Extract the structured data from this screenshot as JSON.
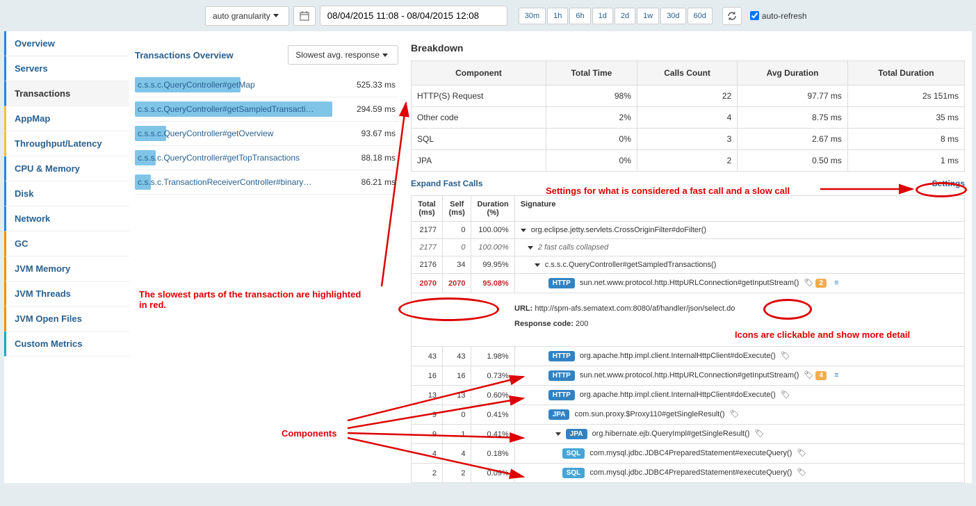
{
  "toolbar": {
    "granularity": "auto granularity",
    "date_range": "08/04/2015 11:08 - 08/04/2015 12:08",
    "ranges": [
      "30m",
      "1h",
      "6h",
      "1d",
      "2d",
      "1w",
      "30d",
      "60d"
    ],
    "auto_refresh": "auto-refresh"
  },
  "sidebar": [
    {
      "label": "Overview",
      "key": "overview"
    },
    {
      "label": "Servers",
      "key": "servers"
    },
    {
      "label": "Transactions",
      "key": "transactions"
    },
    {
      "label": "AppMap",
      "key": "appmap"
    },
    {
      "label": "Throughput/Latency",
      "key": "tl"
    },
    {
      "label": "CPU & Memory",
      "key": "cpu"
    },
    {
      "label": "Disk",
      "key": "disk"
    },
    {
      "label": "Network",
      "key": "network"
    },
    {
      "label": "GC",
      "key": "gc"
    },
    {
      "label": "JVM Memory",
      "key": "jvmm"
    },
    {
      "label": "JVM Threads",
      "key": "jvmt"
    },
    {
      "label": "JVM Open Files",
      "key": "jvmo"
    },
    {
      "label": "Custom Metrics",
      "key": "custom"
    }
  ],
  "trans": {
    "title": "Transactions Overview",
    "sort": "Slowest avg. response",
    "rows": [
      {
        "name": "c.s.s.c.QueryController#getMap",
        "ms": "525.33 ms",
        "w": 40
      },
      {
        "name": "c.s.s.c.QueryController#getSampledTransacti…",
        "ms": "294.59 ms",
        "w": 75
      },
      {
        "name": "c.s.s.c.QueryController#getOverview",
        "ms": "93.67 ms",
        "w": 12
      },
      {
        "name": "c.s.s.c.QueryController#getTopTransactions",
        "ms": "88.18 ms",
        "w": 8
      },
      {
        "name": "c.s.s.c.TransactionReceiverController#binary…",
        "ms": "86.21 ms",
        "w": 6
      }
    ]
  },
  "breakdown": {
    "title": "Breakdown",
    "headers": [
      "Component",
      "Total Time",
      "Calls Count",
      "Avg Duration",
      "Total Duration"
    ],
    "rows": [
      {
        "c": "HTTP(S) Request",
        "tt": "98%",
        "cc": "22",
        "ad": "97.77 ms",
        "td": "2s 151ms"
      },
      {
        "c": "Other code",
        "tt": "2%",
        "cc": "4",
        "ad": "8.75 ms",
        "td": "35 ms"
      },
      {
        "c": "SQL",
        "tt": "0%",
        "cc": "3",
        "ad": "2.67 ms",
        "td": "8 ms"
      },
      {
        "c": "JPA",
        "tt": "0%",
        "cc": "2",
        "ad": "0.50 ms",
        "td": "1 ms"
      }
    ]
  },
  "expand_label": "Expand Fast Calls",
  "settings_label": "Settings",
  "calls": {
    "headers": {
      "total": "Total (ms)",
      "self": "Self (ms)",
      "dur": "Duration (%)",
      "sig": "Signature"
    },
    "rows": [
      {
        "total": "2177",
        "self": "0",
        "dur": "100.00%",
        "sig": "org.eclipse.jetty.servlets.CrossOriginFilter#doFilter()",
        "caret": true
      },
      {
        "total": "2177",
        "self": "0",
        "dur": "100.00%",
        "sig": "2 fast calls collapsed",
        "caret": true,
        "italic": true,
        "indent": 10
      },
      {
        "total": "2176",
        "self": "34",
        "dur": "99.95%",
        "sig": "c.s.s.c.QueryController#getSampledTransactions()",
        "caret": true,
        "indent": 20
      },
      {
        "total": "2070",
        "self": "2070",
        "dur": "95.08%",
        "sig": "sun.net.www.protocol.http.HttpURLConnection#getInputStream()",
        "slow": true,
        "badge": "HTTP",
        "indent": 40,
        "tag": true,
        "count": "2",
        "lines": true
      },
      {
        "total": "43",
        "self": "43",
        "dur": "1.98%",
        "sig": "org.apache.http.impl.client.InternalHttpClient#doExecute()",
        "badge": "HTTP",
        "indent": 40,
        "tag": true
      },
      {
        "total": "16",
        "self": "16",
        "dur": "0.73%",
        "sig": "sun.net.www.protocol.http.HttpURLConnection#getInputStream()",
        "badge": "HTTP",
        "indent": 40,
        "tag": true,
        "count": "4",
        "lines": true
      },
      {
        "total": "13",
        "self": "13",
        "dur": "0.60%",
        "sig": "org.apache.http.impl.client.InternalHttpClient#doExecute()",
        "badge": "HTTP",
        "indent": 40,
        "tag": true
      },
      {
        "total": "9",
        "self": "0",
        "dur": "0.41%",
        "sig": "com.sun.proxy.$Proxy110#getSingleResult()",
        "badge": "JPA",
        "indent": 40,
        "tag": true
      },
      {
        "total": "9",
        "self": "1",
        "dur": "0.41%",
        "sig": "org.hibernate.ejb.QueryImpl#getSingleResult()",
        "badge": "JPA",
        "caret": true,
        "indent": 50,
        "tag": true
      },
      {
        "total": "4",
        "self": "4",
        "dur": "0.18%",
        "sig": "com.mysql.jdbc.JDBC4PreparedStatement#executeQuery()",
        "badge": "SQL",
        "indent": 60,
        "tag": true
      },
      {
        "total": "2",
        "self": "2",
        "dur": "0.09%",
        "sig": "com.mysql.jdbc.JDBC4PreparedStatement#executeQuery()",
        "badge": "SQL",
        "indent": 60,
        "tag": true
      }
    ]
  },
  "detail": {
    "url_label": "URL:",
    "url": "http://spm-afs.sematext.com:8080/af/handler/json/select.do",
    "rc_label": "Response code:",
    "rc": "200"
  },
  "annotations": {
    "slowest": "The slowest parts of the transaction are highlighted in red.",
    "components": "Components",
    "settings": "Settings for what is considered a fast call and a slow call",
    "icons": "Icons are clickable and show more detail"
  },
  "chart_data": {
    "type": "table",
    "title": "Breakdown",
    "columns": [
      "Component",
      "Total Time",
      "Calls Count",
      "Avg Duration",
      "Total Duration"
    ],
    "rows": [
      [
        "HTTP(S) Request",
        "98%",
        22,
        "97.77 ms",
        "2s 151ms"
      ],
      [
        "Other code",
        "2%",
        4,
        "8.75 ms",
        "35 ms"
      ],
      [
        "SQL",
        "0%",
        3,
        "2.67 ms",
        "8 ms"
      ],
      [
        "JPA",
        "0%",
        2,
        "0.50 ms",
        "1 ms"
      ]
    ]
  }
}
